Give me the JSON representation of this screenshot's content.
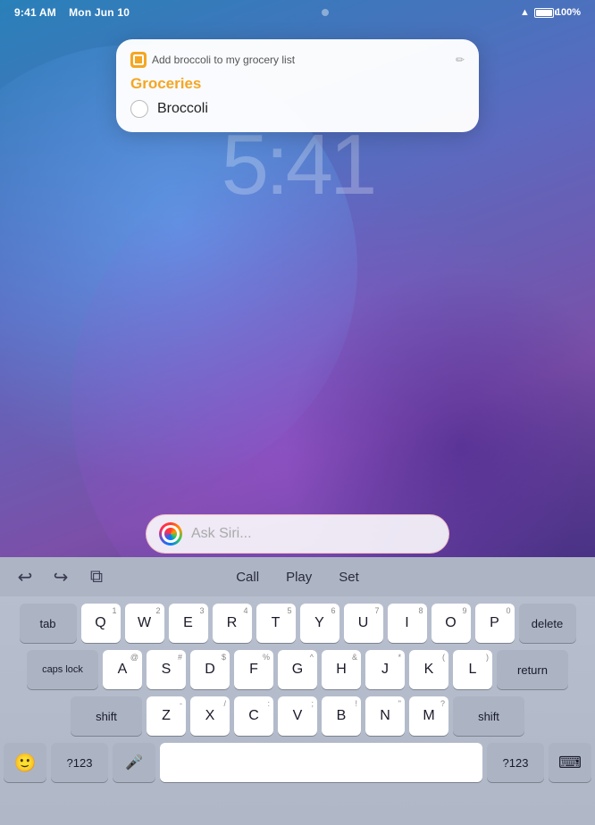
{
  "statusBar": {
    "time": "9:41 AM",
    "date": "Mon Jun 10",
    "battery": "100%",
    "separator": "·"
  },
  "lockTime": "5:41",
  "notification": {
    "appName": "Reminders",
    "headerText": "Add broccoli to my grocery list",
    "editIconText": "✏",
    "listTitle": "Groceries",
    "items": [
      {
        "text": "Broccoli",
        "checked": false
      }
    ]
  },
  "siri": {
    "placeholder": "Ask Siri..."
  },
  "toolbar": {
    "undoLabel": "↩",
    "redoLabel": "↪",
    "copyLabel": "⊞",
    "suggestions": [
      "Call",
      "Play",
      "Set"
    ]
  },
  "keyboard": {
    "rows": [
      [
        "Q",
        "W",
        "E",
        "R",
        "T",
        "Y",
        "U",
        "I",
        "O",
        "P"
      ],
      [
        "A",
        "S",
        "D",
        "F",
        "G",
        "H",
        "J",
        "K",
        "L"
      ],
      [
        "Z",
        "X",
        "C",
        "V",
        "B",
        "N",
        "M"
      ]
    ],
    "subLabels": {
      "Q": "1",
      "W": "2",
      "E": "3",
      "R": "4",
      "T": "5",
      "Y": "6",
      "U": "7",
      "I": "8",
      "O": "9",
      "P": "0",
      "A": "@",
      "S": "#",
      "D": "$",
      "F": "%",
      "G": "^",
      "H": "&",
      "J": "*",
      "K": "(",
      "L": ")",
      "Z": "-",
      "X": "/",
      "C": ":",
      "V": ";",
      "B": "!",
      "N": "\"",
      "M": "?"
    },
    "specialKeys": {
      "tab": "tab",
      "delete": "delete",
      "capsLock": "caps lock",
      "return": "return",
      "shiftLeft": "shift",
      "shiftRight": "shift"
    },
    "bottomRow": {
      "emoji": "🙂",
      "numSymbol": "?123",
      "mic": "🎤",
      "space": " ",
      "numSymbol2": "?123",
      "keyboard": "⌨"
    }
  }
}
